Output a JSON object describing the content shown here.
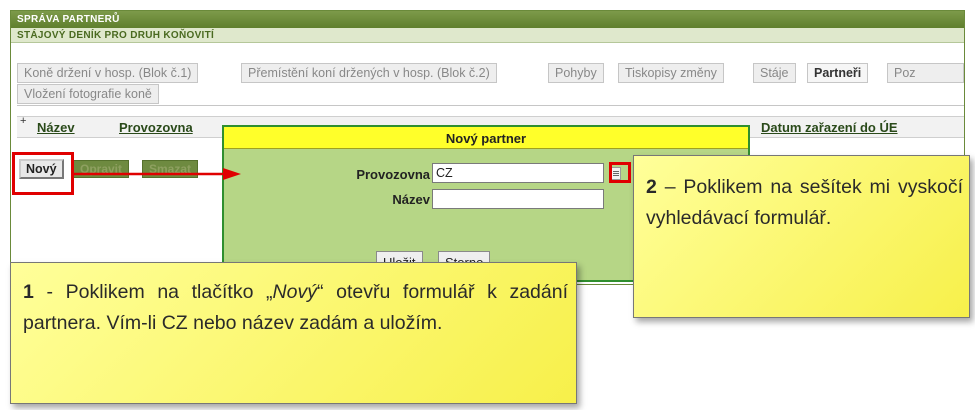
{
  "header": {
    "title": "SPRÁVA PARTNERŮ",
    "subtitle": "STÁJOVÝ DENÍK PRO DRUH KOŇOVITÍ"
  },
  "tabs": [
    {
      "label": "Koně držení v hosp. (Blok č.1)",
      "active": false
    },
    {
      "label": "Přemístění koní držených v hosp. (Blok č.2)",
      "active": false
    },
    {
      "label": "Pohyby",
      "active": false
    },
    {
      "label": "Tiskopisy změny",
      "active": false
    },
    {
      "label": "Stáje",
      "active": false
    },
    {
      "label": "Partneři",
      "active": true
    },
    {
      "label": "Poz",
      "active": false
    },
    {
      "label": "Vložení fotografie koně",
      "active": false
    }
  ],
  "grid": {
    "sort_marker": "+",
    "columns": [
      "Název",
      "Provozovna",
      "Datum zařazení do ÚE"
    ]
  },
  "toolbar": {
    "new_label": "Nový",
    "edit_label": "Opravit",
    "delete_label": "Smazat"
  },
  "dialog": {
    "title": "Nový partner",
    "provozovna_label": "Provozovna",
    "provozovna_value": "CZ",
    "nazev_label": "Název",
    "nazev_value": "",
    "save_label": "Uložit",
    "cancel_label": "Storno"
  },
  "callouts": {
    "c1_num": "1",
    "c1_pre": " - Poklikem na tlačítko „",
    "c1_em": "Nový",
    "c1_post": "“ otevřu formulář k zadání partnera. Vím-li CZ nebo název zadám a uložím.",
    "c2_num": "2",
    "c2_text": " – Poklikem na sešítek mi vyskočí vyhledávací formulář."
  },
  "colors": {
    "header_green": "#5f7f2d",
    "dialog_green": "#b6d686",
    "dialog_title_yellow": "#ffff2a",
    "highlight_red": "#e00000",
    "callout_yellow": "#ffff9a"
  }
}
